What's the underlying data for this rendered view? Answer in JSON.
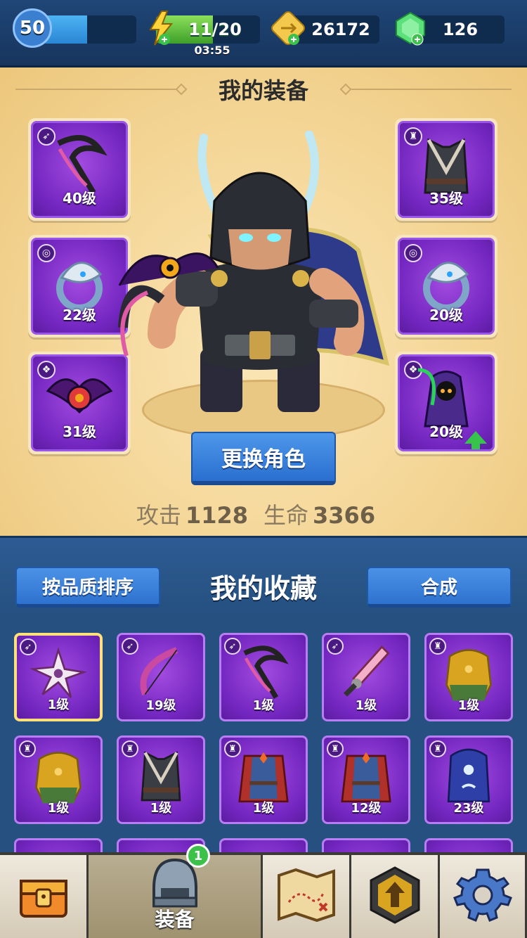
{
  "top_bar": {
    "player_level": "50",
    "xp_fraction": 0.48,
    "energy_text": "11/20",
    "energy_fraction": 0.55,
    "energy_timer": "03:55",
    "gold": "26172",
    "gems": "126"
  },
  "equipment": {
    "title": "我的装备",
    "left_slots": [
      {
        "type_icon": "bow-icon",
        "level": "40级",
        "art": "scythe"
      },
      {
        "type_icon": "ring-icon",
        "level": "22级",
        "art": "ring"
      },
      {
        "type_icon": "pet-icon",
        "level": "31级",
        "art": "bat"
      }
    ],
    "right_slots": [
      {
        "type_icon": "armor-icon",
        "level": "35级",
        "art": "vest-dark"
      },
      {
        "type_icon": "ring-icon",
        "level": "20级",
        "art": "ring"
      },
      {
        "type_icon": "pet-icon",
        "level": "20级",
        "art": "reaper",
        "upgrade": true
      }
    ],
    "change_hero_label": "更换角色",
    "attack_label": "攻击",
    "attack_value": "1128",
    "hp_label": "生命",
    "hp_value": "3366"
  },
  "collection": {
    "title": "我的收藏",
    "sort_label": "按品质排序",
    "merge_label": "合成",
    "items": [
      {
        "type_icon": "bow-icon",
        "level": "1级",
        "art": "shuriken",
        "selected": true
      },
      {
        "type_icon": "bow-icon",
        "level": "19级",
        "art": "bow"
      },
      {
        "type_icon": "bow-icon",
        "level": "1级",
        "art": "scythe"
      },
      {
        "type_icon": "bow-icon",
        "level": "1级",
        "art": "sword"
      },
      {
        "type_icon": "armor-icon",
        "level": "1级",
        "art": "vest-gold"
      },
      {
        "type_icon": "armor-icon",
        "level": "1级",
        "art": "vest-gold"
      },
      {
        "type_icon": "armor-icon",
        "level": "1级",
        "art": "vest-dark"
      },
      {
        "type_icon": "armor-icon",
        "level": "1级",
        "art": "robe-red"
      },
      {
        "type_icon": "armor-icon",
        "level": "12级",
        "art": "robe-red"
      },
      {
        "type_icon": "armor-icon",
        "level": "23级",
        "art": "robe-blue"
      }
    ]
  },
  "bottom_nav": {
    "tabs": [
      {
        "name": "chest",
        "icon": "chest-icon",
        "label": ""
      },
      {
        "name": "equipment",
        "icon": "helmet-icon",
        "label": "装备",
        "badge": "1",
        "active": true
      },
      {
        "name": "map",
        "icon": "map-icon",
        "label": ""
      },
      {
        "name": "upgrade",
        "icon": "upgrade-icon",
        "label": ""
      },
      {
        "name": "settings",
        "icon": "gear-icon",
        "label": ""
      }
    ]
  },
  "colors": {
    "rarity_purple": "#7326c0",
    "panel_gold": "#f3d493",
    "button_blue": "#2a6fcf",
    "upgrade_green": "#37c44a"
  }
}
